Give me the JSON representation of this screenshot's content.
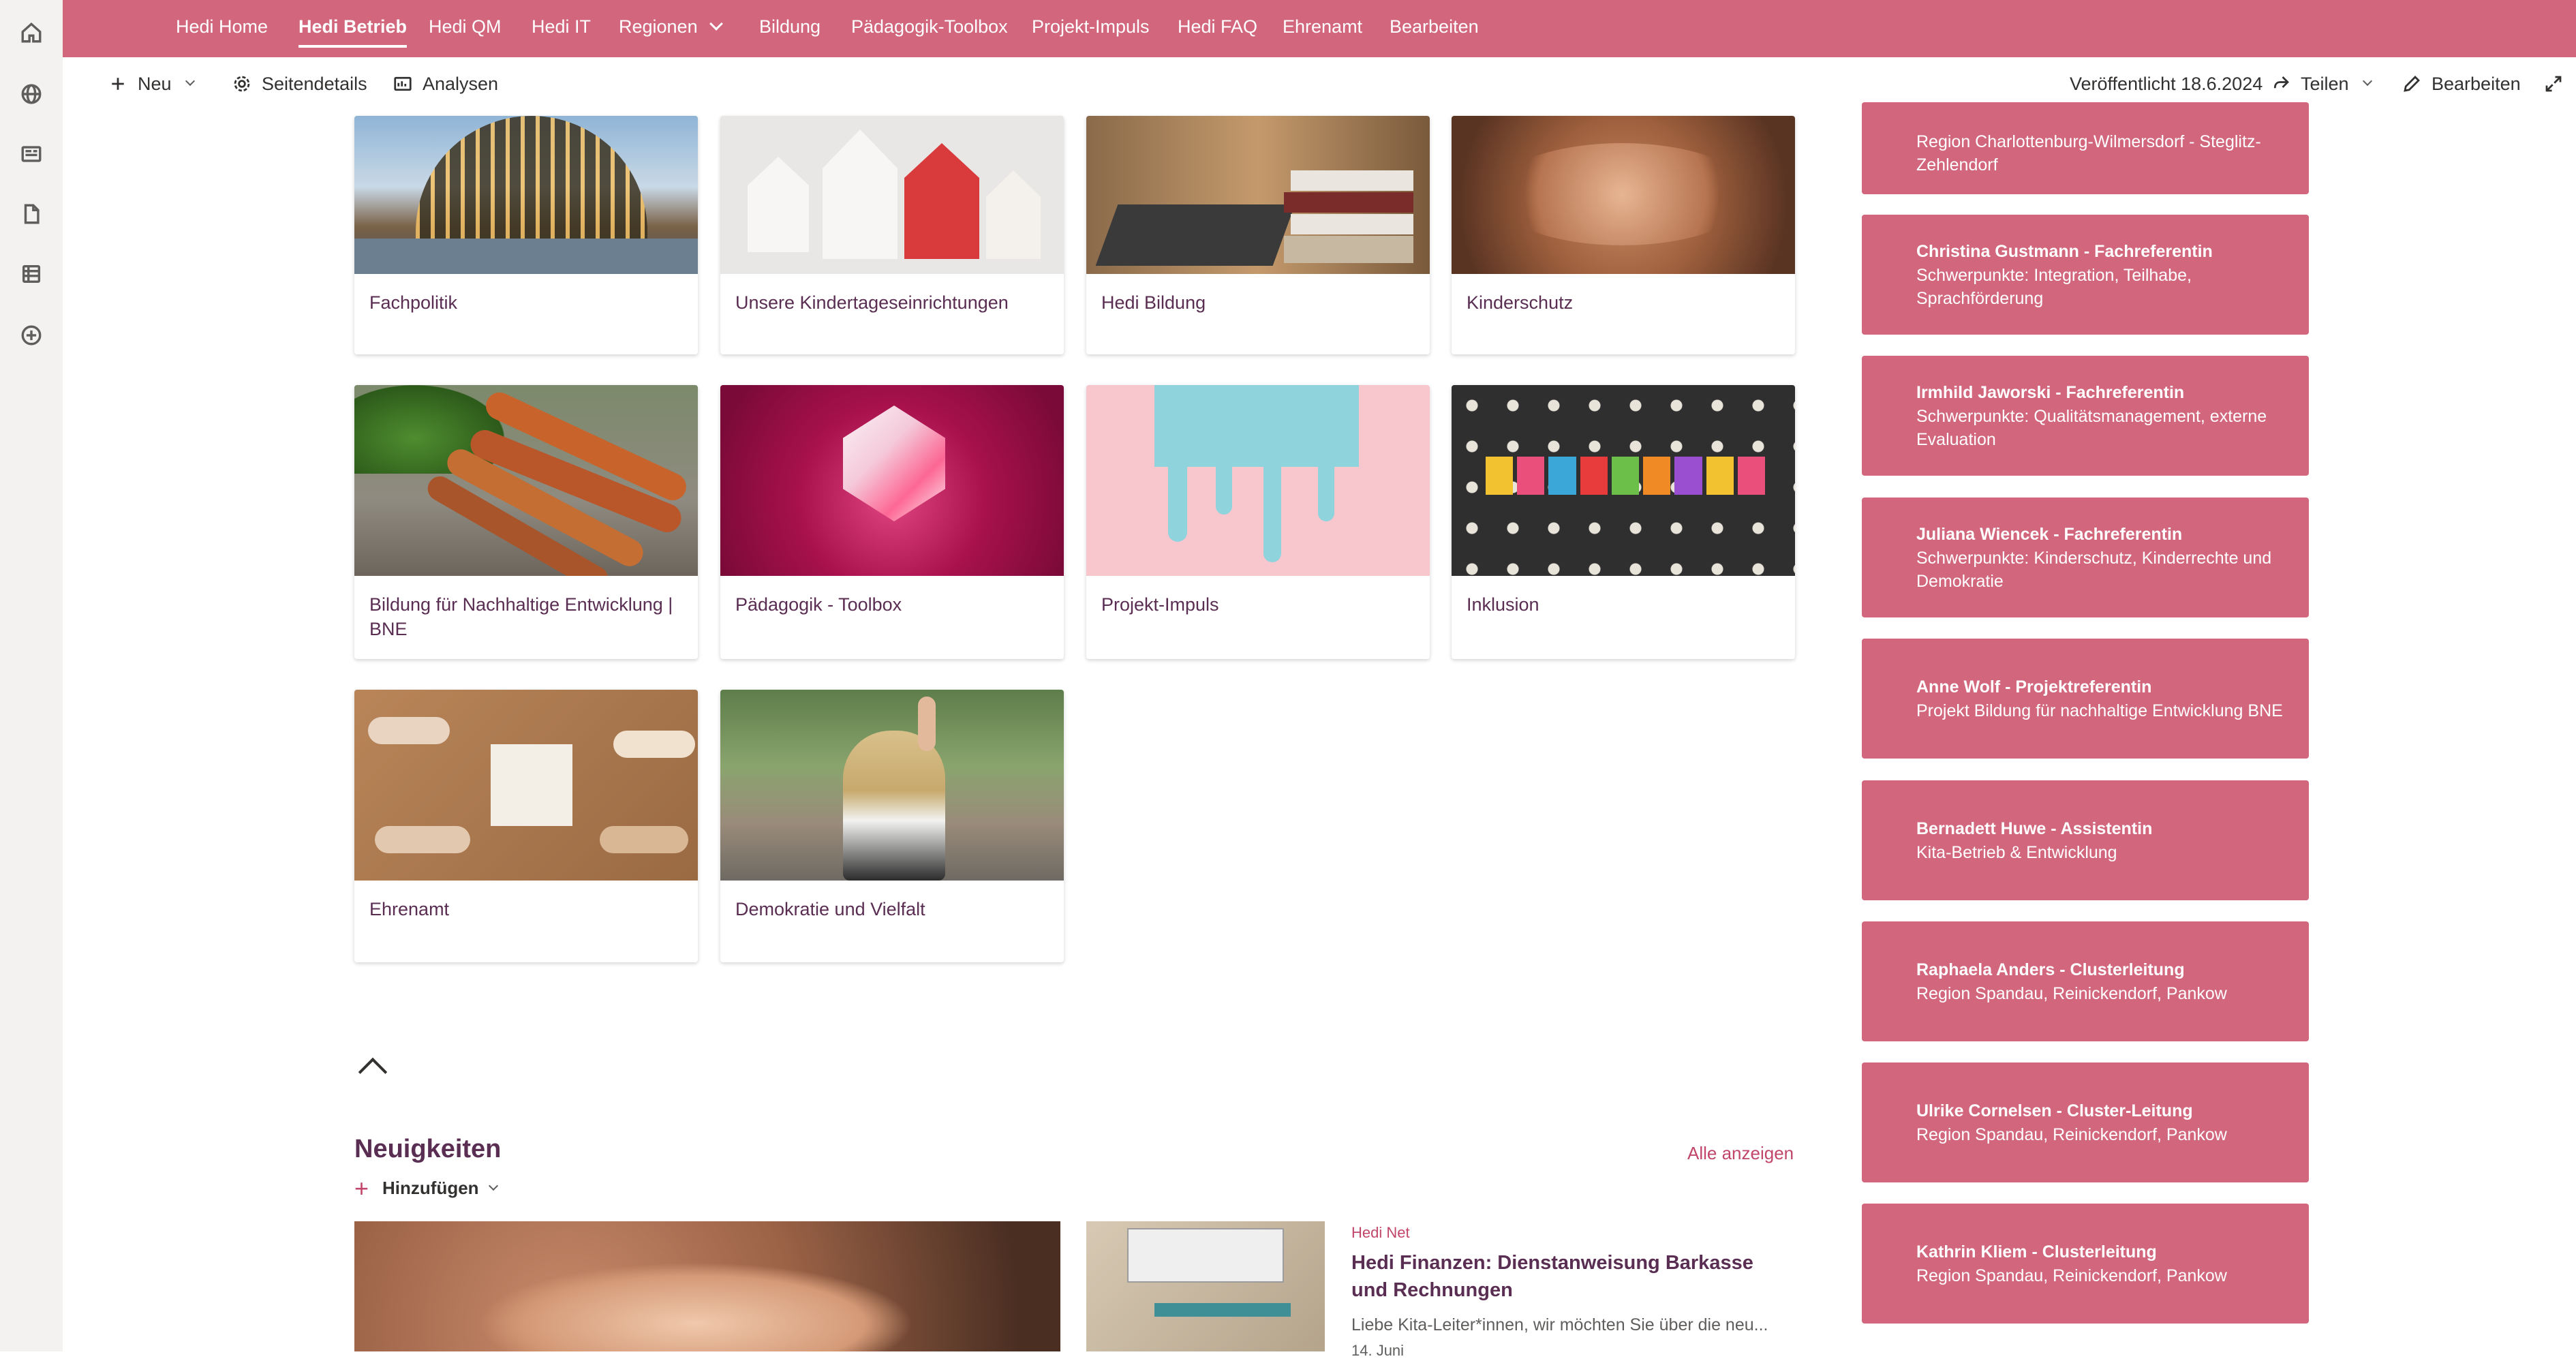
{
  "hub_nav": {
    "items": [
      {
        "label": "Hedi Home",
        "active": false
      },
      {
        "label": "Hedi Betrieb",
        "active": true
      },
      {
        "label": "Hedi QM",
        "active": false
      },
      {
        "label": "Hedi IT",
        "active": false
      },
      {
        "label": "Regionen",
        "active": false,
        "has_dropdown": true
      },
      {
        "label": "Bildung",
        "active": false
      },
      {
        "label": "Pädagogik-Toolbox",
        "active": false
      },
      {
        "label": "Projekt-Impuls",
        "active": false
      },
      {
        "label": "Hedi FAQ",
        "active": false
      },
      {
        "label": "Ehrenamt",
        "active": false
      },
      {
        "label": "Bearbeiten",
        "active": false
      }
    ]
  },
  "command_bar": {
    "new_label": "Neu",
    "page_details_label": "Seitendetails",
    "analytics_label": "Analysen",
    "published_label": "Veröffentlicht 18.6.2024",
    "share_label": "Teilen",
    "edit_label": "Bearbeiten"
  },
  "tiles": [
    {
      "title": "Fachpolitik",
      "image": "reichstag-dome"
    },
    {
      "title": "Unsere Kindertageseinrichtungen",
      "image": "paper-houses"
    },
    {
      "title": "Hedi Bildung",
      "image": "books-laptop"
    },
    {
      "title": "Kinderschutz",
      "image": "stacked-hands"
    },
    {
      "title": "Bildung für Nachhaltige Entwicklung | BNE",
      "image": "carrots"
    },
    {
      "title": "Pädagogik - Toolbox",
      "image": "glass-cube"
    },
    {
      "title": "Projekt-Impuls",
      "image": "paint-drip"
    },
    {
      "title": "Inklusion",
      "image": "letter-dice"
    },
    {
      "title": "Ehrenamt",
      "image": "puzzle-hands"
    },
    {
      "title": "Demokratie und Vielfalt",
      "image": "demonstration"
    }
  ],
  "news": {
    "title": "Neuigkeiten",
    "see_all": "Alle anzeigen",
    "add_label": "Hinzufügen",
    "item": {
      "source": "Hedi Net",
      "title": "Hedi Finanzen: Dienstanweisung Barkasse und Rechnungen",
      "excerpt": "Liebe Kita-Leiter*innen, wir möchten Sie über die neu...",
      "date": "14. Juni"
    }
  },
  "contacts": [
    {
      "name": "",
      "desc": "Region Charlottenburg-Wilmersdorf - Steglitz-Zehlendorf"
    },
    {
      "name": "Christina Gustmann - Fachreferentin",
      "desc": "Schwerpunkte: Integration, Teilhabe, Sprachförderung"
    },
    {
      "name": "Irmhild Jaworski - Fachreferentin",
      "desc": "Schwerpunkte: Qualitätsmanagement, externe Evaluation"
    },
    {
      "name": "Juliana Wiencek - Fachreferentin",
      "desc": "Schwerpunkte: Kinderschutz, Kinderrechte und Demokratie"
    },
    {
      "name": "Anne Wolf - Projektreferentin",
      "desc": "Projekt Bildung für nachhaltige Entwicklung BNE"
    },
    {
      "name": "Bernadett Huwe - Assistentin",
      "desc": "Kita-Betrieb & Entwicklung"
    },
    {
      "name": "Raphaela Anders - Clusterleitung",
      "desc": "Region Spandau, Reinickendorf, Pankow"
    },
    {
      "name": "Ulrike Cornelsen - Cluster-Leitung",
      "desc": "Region Spandau, Reinickendorf, Pankow"
    },
    {
      "name": "Kathrin Kliem - Clusterleitung",
      "desc": "Region Spandau, Reinickendorf, Pankow"
    }
  ],
  "colors": {
    "brand_pink": "#d1667d",
    "tile_title": "#5a2d52",
    "link_accent": "#c2466a"
  }
}
